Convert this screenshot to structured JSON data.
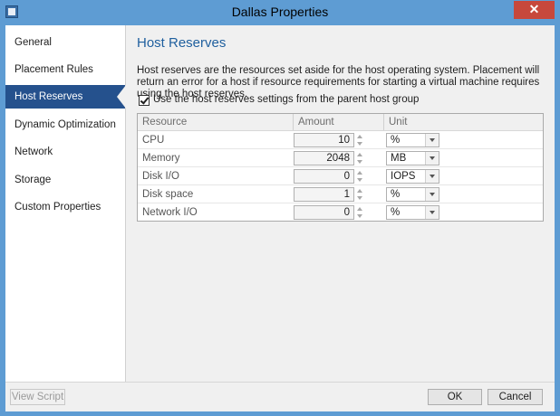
{
  "window": {
    "title": "Dallas Properties",
    "close_glyph": "✕"
  },
  "sidebar": {
    "items": [
      {
        "label": "General"
      },
      {
        "label": "Placement Rules"
      },
      {
        "label": "Host Reserves"
      },
      {
        "label": "Dynamic Optimization"
      },
      {
        "label": "Network"
      },
      {
        "label": "Storage"
      },
      {
        "label": "Custom Properties"
      }
    ],
    "selected": "Host Reserves"
  },
  "main": {
    "heading": "Host Reserves",
    "description": "Host reserves are the resources set aside for the host operating system.  Placement will return an error for a host if resource requirements for starting a virtual machine requires using the host reserves.",
    "checkbox": {
      "label": "Use the host reserves settings from the parent host group",
      "checked": true
    },
    "grid": {
      "columns": [
        "Resource",
        "Amount",
        "Unit"
      ],
      "rows": [
        {
          "resource": "CPU",
          "amount": "10",
          "unit": "%"
        },
        {
          "resource": "Memory",
          "amount": "2048",
          "unit": "MB"
        },
        {
          "resource": "Disk I/O",
          "amount": "0",
          "unit": "IOPS"
        },
        {
          "resource": "Disk space",
          "amount": "1",
          "unit": "%"
        },
        {
          "resource": "Network I/O",
          "amount": "0",
          "unit": "%"
        }
      ]
    }
  },
  "footer": {
    "view_script": "View Script",
    "ok": "OK",
    "cancel": "Cancel"
  },
  "colors": {
    "accent": "#25518d",
    "heading": "#1f5f9e",
    "frame": "#5e9cd3",
    "close": "#c7483c"
  }
}
